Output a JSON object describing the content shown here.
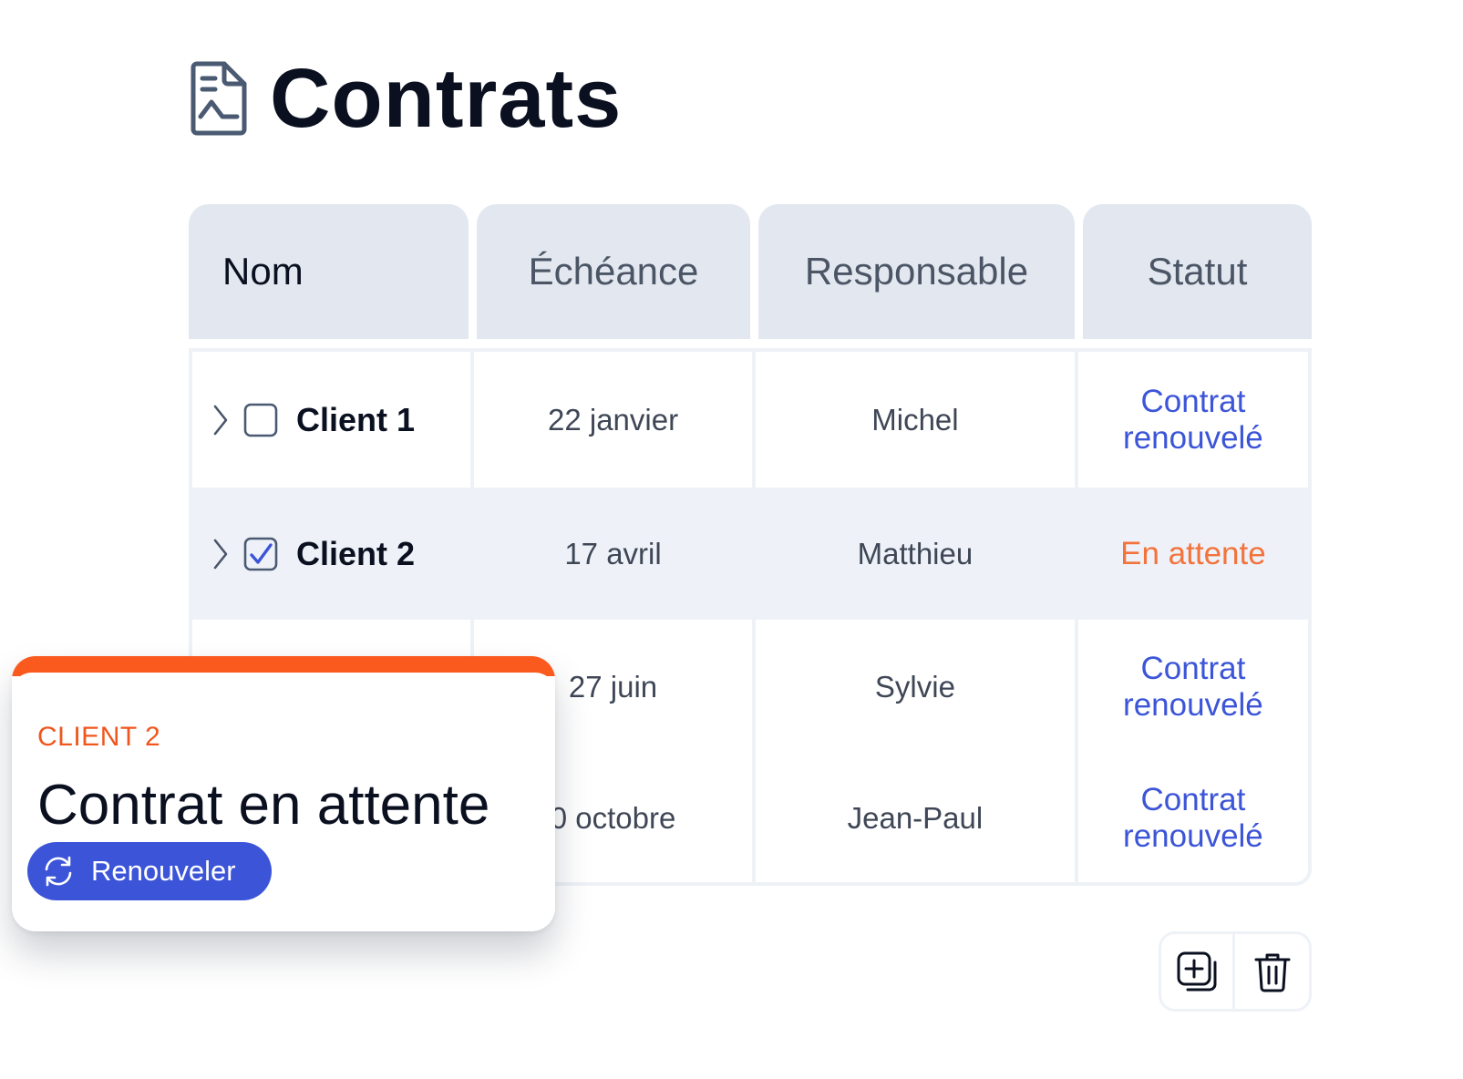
{
  "header": {
    "title": "Contrats",
    "icon": "contract-document-icon"
  },
  "table": {
    "columns": [
      "Nom",
      "Échéance",
      "Responsable",
      "Statut"
    ],
    "rows": [
      {
        "name": "Client 1",
        "checked": false,
        "date": "22 janvier",
        "owner": "Michel",
        "status_line1": "Contrat",
        "status_line2": "renouvelé",
        "status_color": "#3c55d8"
      },
      {
        "name": "Client 2",
        "checked": true,
        "date": "17 avril",
        "owner": "Matthieu",
        "status_line1": "En attente",
        "status_line2": "",
        "status_color": "#f3733c"
      },
      {
        "name": "",
        "checked": false,
        "date": "27 juin",
        "owner": "Sylvie",
        "status_line1": "Contrat",
        "status_line2": "renouvelé",
        "status_color": "#3c55d8"
      },
      {
        "name": "",
        "checked": false,
        "date": "0 octobre",
        "owner": "Jean-Paul",
        "status_line1": "Contrat",
        "status_line2": "renouvelé",
        "status_color": "#3c55d8"
      }
    ]
  },
  "toolbar": {
    "add_icon": "add-copy-icon",
    "delete_icon": "trash-icon"
  },
  "popup": {
    "label": "CLIENT 2",
    "title": "Contrat en attente",
    "button_label": "Renouveler",
    "button_icon": "refresh-icon",
    "accent_color": "#fb5a1e",
    "button_color": "#3c55d8"
  }
}
